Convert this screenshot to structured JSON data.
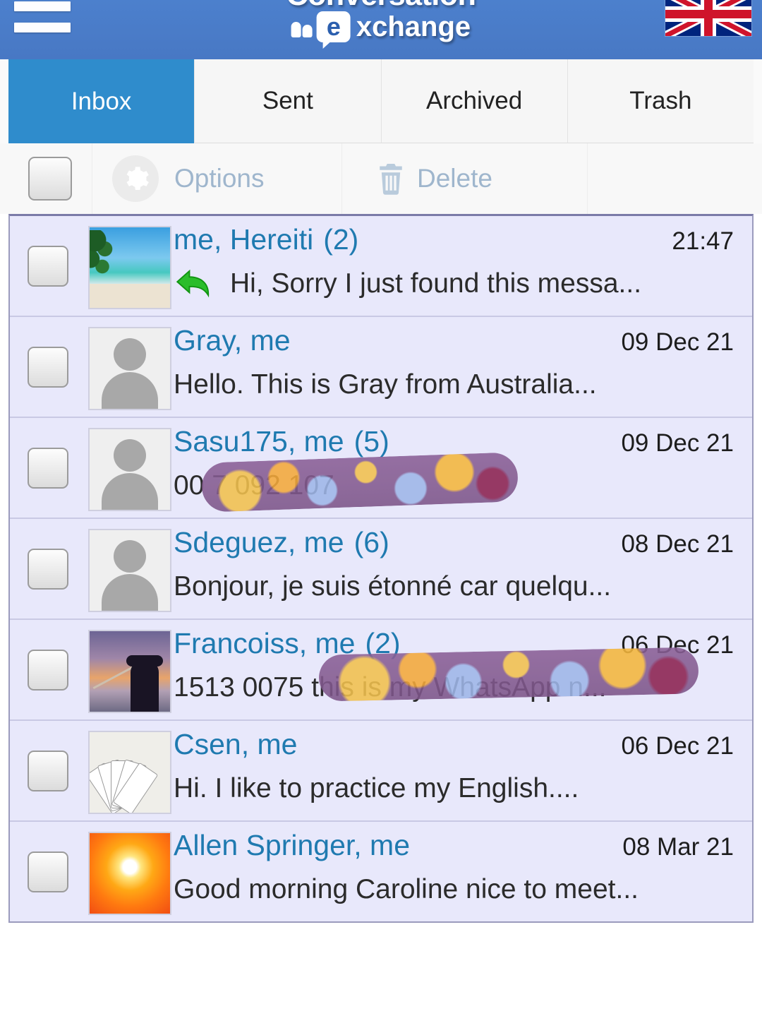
{
  "header": {
    "menu_icon": "hamburger-icon",
    "logo_line1": "Conversation",
    "logo_line2_e": "e",
    "logo_line2_rest": "xchange",
    "flag_icon": "uk-flag-icon"
  },
  "tabs": [
    {
      "label": "Inbox",
      "active": true
    },
    {
      "label": "Sent",
      "active": false
    },
    {
      "label": "Archived",
      "active": false
    },
    {
      "label": "Trash",
      "active": false
    }
  ],
  "toolbar": {
    "select_all_checkbox": "",
    "options_label": "Options",
    "options_icon": "gear-icon",
    "delete_label": "Delete",
    "delete_icon": "trash-icon"
  },
  "colors": {
    "header_blue": "#4a7ecb",
    "tab_active_blue": "#2f8ccc",
    "name_link_blue": "#1f7ab0",
    "list_background": "#e8e8fb",
    "toolbar_muted": "#9fb6cd",
    "redaction_purple": "#7d5589"
  },
  "messages": [
    {
      "name": "me, Hereiti",
      "count": "(2)",
      "date": "21:47",
      "preview": "Hi, Sorry I just found this messa...",
      "avatar": "beach-photo",
      "replied": true,
      "redacted": false
    },
    {
      "name": "Gray, me",
      "count": "",
      "date": "09 Dec 21",
      "preview": "Hello. This is Gray from Australia...",
      "avatar": "default-person",
      "replied": false,
      "redacted": false
    },
    {
      "name": "Sasu175, me",
      "count": "(5)",
      "date": "09 Dec 21",
      "preview": "00 7 092 107",
      "avatar": "default-person",
      "replied": false,
      "redacted": true
    },
    {
      "name": "Sdeguez, me",
      "count": "(6)",
      "date": "08 Dec 21",
      "preview": "Bonjour, je suis étonné car quelqu...",
      "avatar": "default-person",
      "replied": false,
      "redacted": false
    },
    {
      "name": "Francoiss, me",
      "count": "(2)",
      "date": "06 Dec 21",
      "preview": "1513      0075 this is my WhatsApp n...",
      "avatar": "fisherman-photo",
      "replied": false,
      "redacted": true
    },
    {
      "name": "Csen, me",
      "count": "",
      "date": "06 Dec 21",
      "preview": "Hi. I like to practice my English....",
      "avatar": "playing-cards-photo",
      "replied": false,
      "redacted": false
    },
    {
      "name": "Allen Springer, me",
      "count": "",
      "date": "08 Mar 21",
      "preview": "Good morning Caroline nice to meet...",
      "avatar": "sunset-photo",
      "replied": false,
      "redacted": false
    }
  ]
}
